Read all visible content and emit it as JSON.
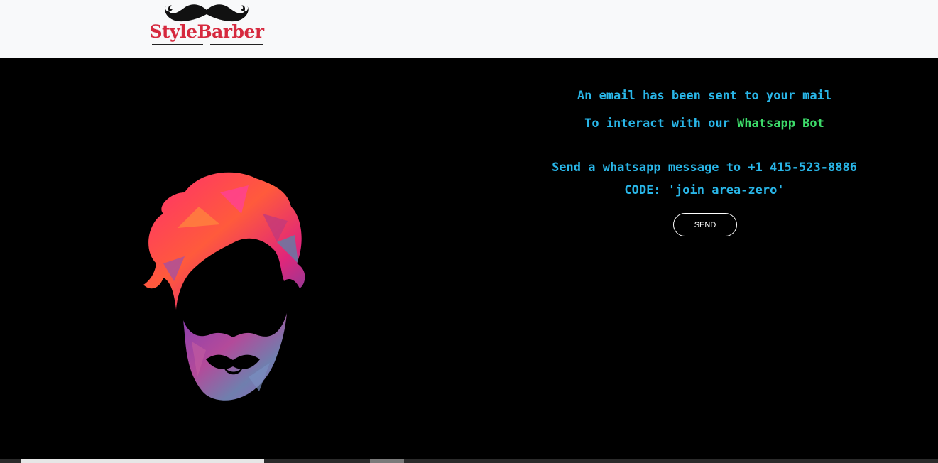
{
  "header": {
    "logo_text": "StyleBarber",
    "logo_icon": "mustache-icon"
  },
  "main": {
    "illustration": "bearded-man-head-icon",
    "email_notice": "An email has been sent to your mail",
    "interact_prefix": "To interact with our ",
    "interact_highlight": "Whatsapp Bot",
    "send_instruction": "Send a whatsapp message to +1 415-523-8886",
    "code_line": "CODE: 'join area-zero'",
    "send_button_label": "SEND"
  },
  "colors": {
    "header_bg": "#f8f9fa",
    "main_bg": "#000000",
    "text_blue": "#29b6e8",
    "text_green": "#3ddc6a",
    "logo_red": "#d6293e"
  }
}
